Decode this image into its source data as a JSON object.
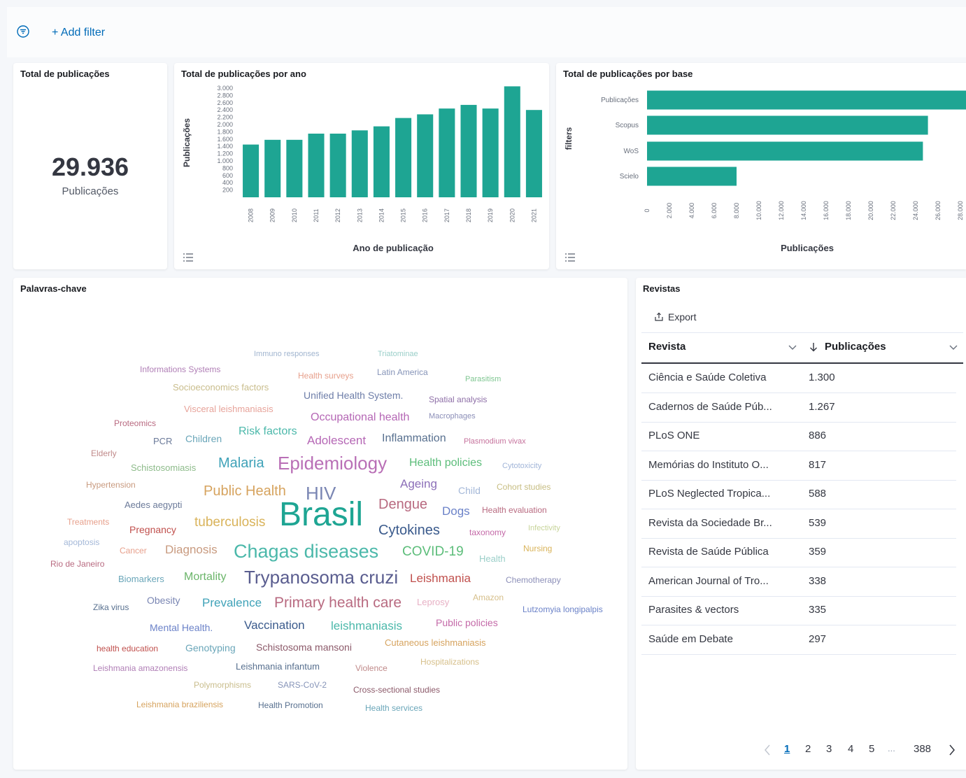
{
  "filter_bar": {
    "add_filter_label": "+ Add filter"
  },
  "metric_panel": {
    "title": "Total de publicações",
    "value": "29.936",
    "label": "Publicações"
  },
  "year_panel": {
    "title": "Total de publicações por ano",
    "chart_data": {
      "type": "bar",
      "title": "Total de publicações por ano",
      "xlabel": "Ano de publicação",
      "ylabel": "Publicações",
      "categories": [
        "2008",
        "2009",
        "2010",
        "2011",
        "2012",
        "2013",
        "2014",
        "2015",
        "2016",
        "2017",
        "2018",
        "2019",
        "2020",
        "2021"
      ],
      "values": [
        1450,
        1580,
        1580,
        1750,
        1750,
        1840,
        1950,
        2180,
        2280,
        2440,
        2540,
        2440,
        3050,
        2400
      ],
      "ylim": [
        0,
        3000
      ],
      "yticks": [
        "200",
        "400",
        "600",
        "800",
        "1.000",
        "1.200",
        "1.400",
        "1.600",
        "1.800",
        "2.000",
        "2.200",
        "2.400",
        "2.600",
        "2.800",
        "3.000"
      ],
      "color": "#1ea593"
    }
  },
  "base_panel": {
    "title": "Total de publicações por base",
    "chart_data": {
      "type": "bar",
      "orientation": "horizontal",
      "title": "Total de publicações por base",
      "xlabel": "Publicações",
      "ylabel": "filters",
      "categories": [
        "Publicações",
        "Scopus",
        "WoS",
        "Scielo"
      ],
      "values": [
        29936,
        25100,
        24650,
        8000
      ],
      "xlim": [
        0,
        30000
      ],
      "xticks": [
        "0",
        "2.000",
        "4.000",
        "6.000",
        "8.000",
        "10.000",
        "12.000",
        "14.000",
        "16.000",
        "18.000",
        "20.000",
        "22.000",
        "24.000",
        "26.000",
        "28.000"
      ],
      "color": "#1ea593"
    }
  },
  "wordcloud_panel": {
    "title": "Palavras-chave",
    "words": [
      {
        "text": "Immuno responses",
        "color": "#a1b5cf"
      },
      {
        "text": "Triatominae",
        "color": "#9bcfc9"
      },
      {
        "text": "Informations Systems",
        "color": "#b07fb6"
      },
      {
        "text": "Health surveys",
        "color": "#e7a08c"
      },
      {
        "text": "Latin America",
        "color": "#8694b8"
      },
      {
        "text": "Parasitism",
        "color": "#7fc691"
      },
      {
        "text": "Socioeconomics factors",
        "color": "#c9bd8c"
      },
      {
        "text": "Unified Health System.",
        "color": "#6d7da8"
      },
      {
        "text": "Spatial analysis",
        "color": "#8e6fa7"
      },
      {
        "text": "Visceral leishmaniasis",
        "color": "#e7a39a"
      },
      {
        "text": "Occupational health",
        "color": "#b567b5"
      },
      {
        "text": "Macrophages",
        "color": "#8c8fb8"
      },
      {
        "text": "Proteomics",
        "color": "#b86a80"
      },
      {
        "text": "Risk factors",
        "color": "#4bb8aa"
      },
      {
        "text": "PCR",
        "color": "#6b7a99"
      },
      {
        "text": "Children",
        "color": "#6aa6b9"
      },
      {
        "text": "Adolescent",
        "color": "#b567b5"
      },
      {
        "text": "Inflammation",
        "color": "#58708f"
      },
      {
        "text": "Plasmodium vivax",
        "color": "#c6739d"
      },
      {
        "text": "Elderly",
        "color": "#c08a8a"
      },
      {
        "text": "Malaria",
        "color": "#3fa2b8"
      },
      {
        "text": "Epidemiology",
        "color": "#b96fb6"
      },
      {
        "text": "Health policies",
        "color": "#5cbd7a"
      },
      {
        "text": "Cytotoxicity",
        "color": "#a1b5d8"
      },
      {
        "text": "Schistosomiasis",
        "color": "#8dbb8a"
      },
      {
        "text": "Hypertension",
        "color": "#c89a7f"
      },
      {
        "text": "Public Health",
        "color": "#d6a35e"
      },
      {
        "text": "HIV",
        "color": "#7a86b3"
      },
      {
        "text": "Ageing",
        "color": "#8c6fb8"
      },
      {
        "text": "Child",
        "color": "#a4b8d8"
      },
      {
        "text": "Cohort studies",
        "color": "#c7bd82"
      },
      {
        "text": "Aedes aegypti",
        "color": "#6b7a99"
      },
      {
        "text": "Brasil",
        "color": "#1ea593"
      },
      {
        "text": "Dengue",
        "color": "#b86a80"
      },
      {
        "text": "Treatments",
        "color": "#e7a08c"
      },
      {
        "text": "tuberculosis",
        "color": "#d9b35a"
      },
      {
        "text": "Dogs",
        "color": "#6b82c8"
      },
      {
        "text": "Health evaluation",
        "color": "#b86a80"
      },
      {
        "text": "Pregnancy",
        "color": "#c0504d"
      },
      {
        "text": "Cytokines",
        "color": "#3a5a8c"
      },
      {
        "text": "taxonomy",
        "color": "#c46aa8"
      },
      {
        "text": "Infectivity",
        "color": "#c7d49a"
      },
      {
        "text": "apoptosis",
        "color": "#a4b8d8"
      },
      {
        "text": "Cancer",
        "color": "#e7a08c"
      },
      {
        "text": "Diagnosis",
        "color": "#c89a7f"
      },
      {
        "text": "Chagas diseases",
        "color": "#4bb8aa"
      },
      {
        "text": "COVID-19",
        "color": "#5cbd7a"
      },
      {
        "text": "Nursing",
        "color": "#d9b35a"
      },
      {
        "text": "Health",
        "color": "#9bcfc9"
      },
      {
        "text": "Rio de Janeiro",
        "color": "#b86a80"
      },
      {
        "text": "Biomarkers",
        "color": "#6aa6b9"
      },
      {
        "text": "Mortality",
        "color": "#6bb56a"
      },
      {
        "text": "Trypanosoma cruzi",
        "color": "#5a5d8f"
      },
      {
        "text": "Leishmania",
        "color": "#c0504d"
      },
      {
        "text": "Chemotherapy",
        "color": "#8c8fb8"
      },
      {
        "text": "Obesity",
        "color": "#7a86b3"
      },
      {
        "text": "Prevalence",
        "color": "#3fa2b8"
      },
      {
        "text": "Primary health care",
        "color": "#b86a80"
      },
      {
        "text": "Leprosy",
        "color": "#e7b0c4"
      },
      {
        "text": "Amazon",
        "color": "#d6bf8a"
      },
      {
        "text": "Zika virus",
        "color": "#58708f"
      },
      {
        "text": "Lutzomyia longipalpis",
        "color": "#6b82c8"
      },
      {
        "text": "Mental Health.",
        "color": "#6b82c8"
      },
      {
        "text": "Vaccination",
        "color": "#3a5a8c"
      },
      {
        "text": "leishmaniasis",
        "color": "#4bb8aa"
      },
      {
        "text": "Public policies",
        "color": "#c46aa8"
      },
      {
        "text": "health education",
        "color": "#c0504d"
      },
      {
        "text": "Genotyping",
        "color": "#6aa6b9"
      },
      {
        "text": "Schistosoma mansoni",
        "color": "#8c5a6a"
      },
      {
        "text": "Cutaneous leishmaniasis",
        "color": "#d6a35e"
      },
      {
        "text": "Hospitalizations",
        "color": "#d6bf8a"
      },
      {
        "text": "Leishmania amazonensis",
        "color": "#b07fb6"
      },
      {
        "text": "Leishmania infantum",
        "color": "#58708f"
      },
      {
        "text": "Violence",
        "color": "#c08a8a"
      },
      {
        "text": "Polymorphisms",
        "color": "#c9bd8c"
      },
      {
        "text": "SARS-CoV-2",
        "color": "#8694b8"
      },
      {
        "text": "Cross-sectional studies",
        "color": "#8c5a6a"
      },
      {
        "text": "Leishmania braziliensis",
        "color": "#d6a35e"
      },
      {
        "text": "Health Promotion",
        "color": "#58708f"
      },
      {
        "text": "Health services",
        "color": "#6aa6b9"
      }
    ]
  },
  "journals_panel": {
    "title": "Revistas",
    "export_label": "Export",
    "columns": [
      "Revista",
      "Publicações"
    ],
    "rows": [
      {
        "name": "Ciência e Saúde Coletiva",
        "count": "1.300"
      },
      {
        "name": "Cadernos de Saúde Púb...",
        "count": "1.267"
      },
      {
        "name": "PLoS ONE",
        "count": "886"
      },
      {
        "name": "Memórias do Instituto O...",
        "count": "817"
      },
      {
        "name": "PLoS Neglected Tropica...",
        "count": "588"
      },
      {
        "name": "Revista da Sociedade Br...",
        "count": "539"
      },
      {
        "name": "Revista de Saúde Pública",
        "count": "359"
      },
      {
        "name": "American Journal of Tro...",
        "count": "338"
      },
      {
        "name": "Parasites & vectors",
        "count": "335"
      },
      {
        "name": "Saúde em Debate",
        "count": "297"
      }
    ],
    "pagination": {
      "pages": [
        "1",
        "2",
        "3",
        "4",
        "5"
      ],
      "ellipsis": "...",
      "last": "388",
      "current": "1"
    }
  },
  "colors": {
    "accent": "#1ea593",
    "link": "#006bb8"
  }
}
